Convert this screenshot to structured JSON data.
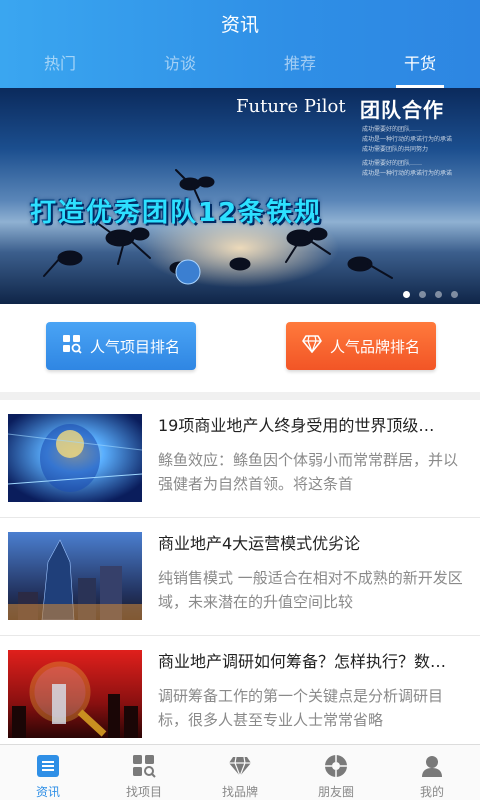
{
  "header": {
    "title": "资讯"
  },
  "tabs": [
    {
      "label": "热门",
      "active": false
    },
    {
      "label": "访谈",
      "active": false
    },
    {
      "label": "推荐",
      "active": false
    },
    {
      "label": "干货",
      "active": true
    }
  ],
  "banner": {
    "english_title": "Future Pilot",
    "chinese_title": "团队合作",
    "small_lines": [
      "成功需要好的团队……",
      "成功是一种行动的承诺行为的承诺",
      "成功需要团队的共同努力",
      "成功需要好的团队……",
      "成功是一种行动的承诺行为的承诺"
    ],
    "headline": "打造优秀团队12条铁规",
    "slide_count": 4,
    "active_slide": 1
  },
  "quick_actions": {
    "project_rank": "人气项目排名",
    "brand_rank": "人气品牌排名"
  },
  "articles": [
    {
      "title": "19项商业地产人终身受用的世界顶级…",
      "summary": "鲦鱼效应：鲦鱼因个体弱小而常常群居，并以强健者为自然首领。将这条首"
    },
    {
      "title": "商业地产4大运营模式优劣论",
      "summary": "纯销售模式 一般适合在相对不成熟的新开发区域，未来潜在的升值空间比较"
    },
    {
      "title": "商业地产调研如何筹备？怎样执行？数…",
      "summary": " 调研筹备工作的第一个关键点是分析调研目标，很多人甚至专业人士常常省略"
    }
  ],
  "bottom_nav": [
    {
      "label": "资讯",
      "icon": "news-icon",
      "active": true
    },
    {
      "label": "找项目",
      "icon": "find-project-icon",
      "active": false
    },
    {
      "label": "找品牌",
      "icon": "diamond-icon",
      "active": false
    },
    {
      "label": "朋友圈",
      "icon": "aperture-icon",
      "active": false
    },
    {
      "label": "我的",
      "icon": "user-icon",
      "active": false
    }
  ],
  "colors": {
    "primary": "#2f8fe6",
    "accent_orange": "#f25526"
  }
}
